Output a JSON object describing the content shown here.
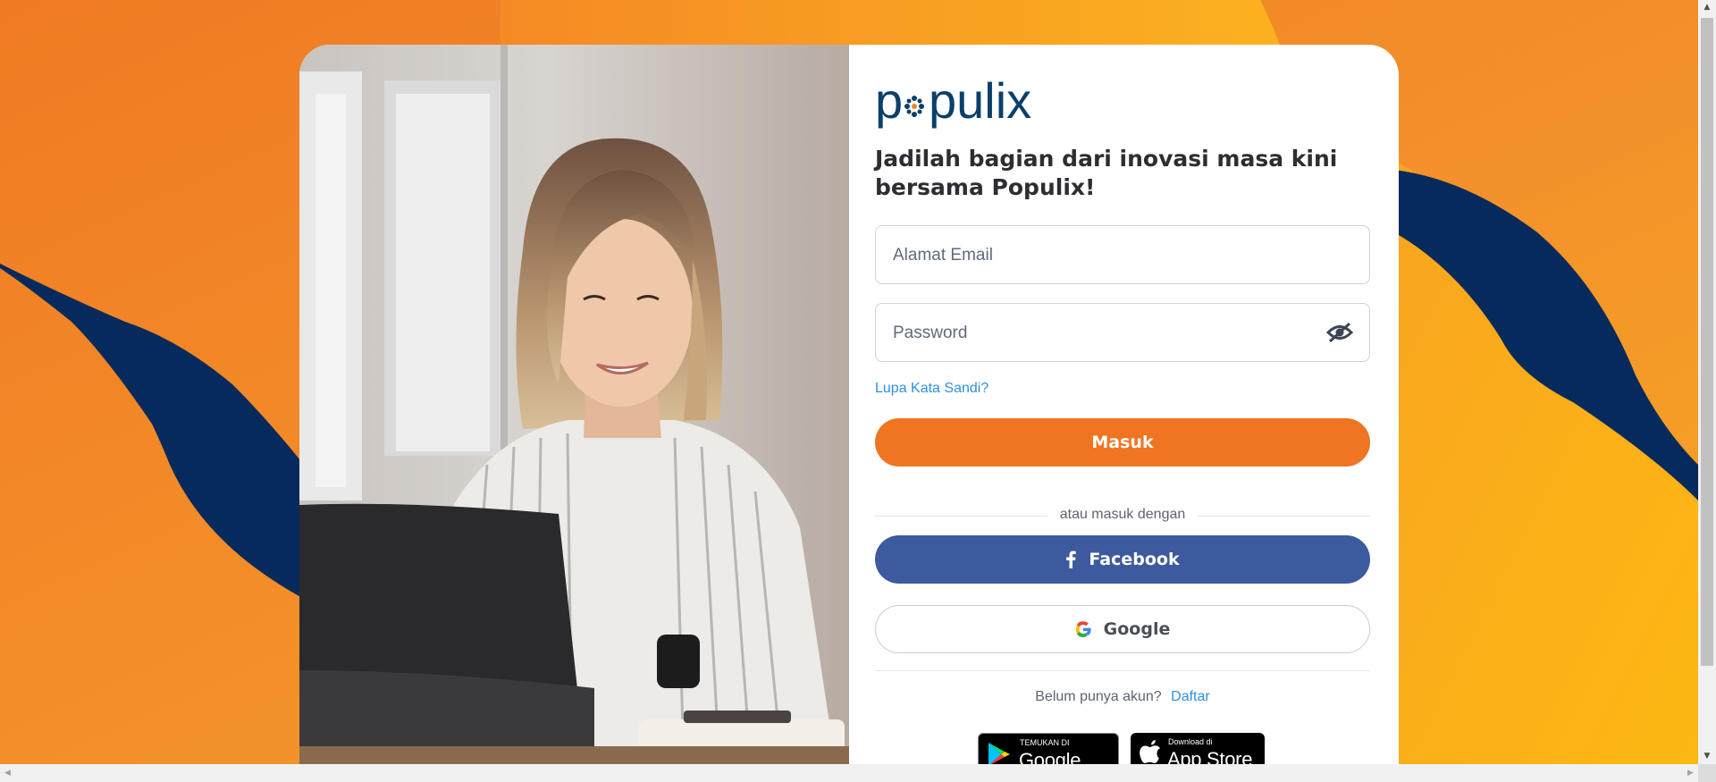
{
  "brand": {
    "name": "populix",
    "colors": {
      "orange": "#ef7522",
      "navy": "#062a5c",
      "amber": "#f9a620",
      "facebook": "#3d5a9e",
      "link": "#2f8fe0"
    }
  },
  "headline": "Jadilah bagian dari inovasi masa kini bersama Populix!",
  "form": {
    "email_placeholder": "Alamat Email",
    "password_placeholder": "Password",
    "password_toggle_icon": "eye-off-icon",
    "forgot_label": "Lupa Kata Sandi?",
    "login_label": "Masuk",
    "divider_text": "atau masuk dengan",
    "facebook_label": "Facebook",
    "google_label": "Google"
  },
  "register": {
    "prompt": "Belum punya akun?",
    "link_label": "Daftar"
  },
  "stores": {
    "google_play_small": "TEMUKAN DI",
    "google_play_big": "Google Play",
    "app_store_small": "Download di",
    "app_store_big": "App Store"
  }
}
